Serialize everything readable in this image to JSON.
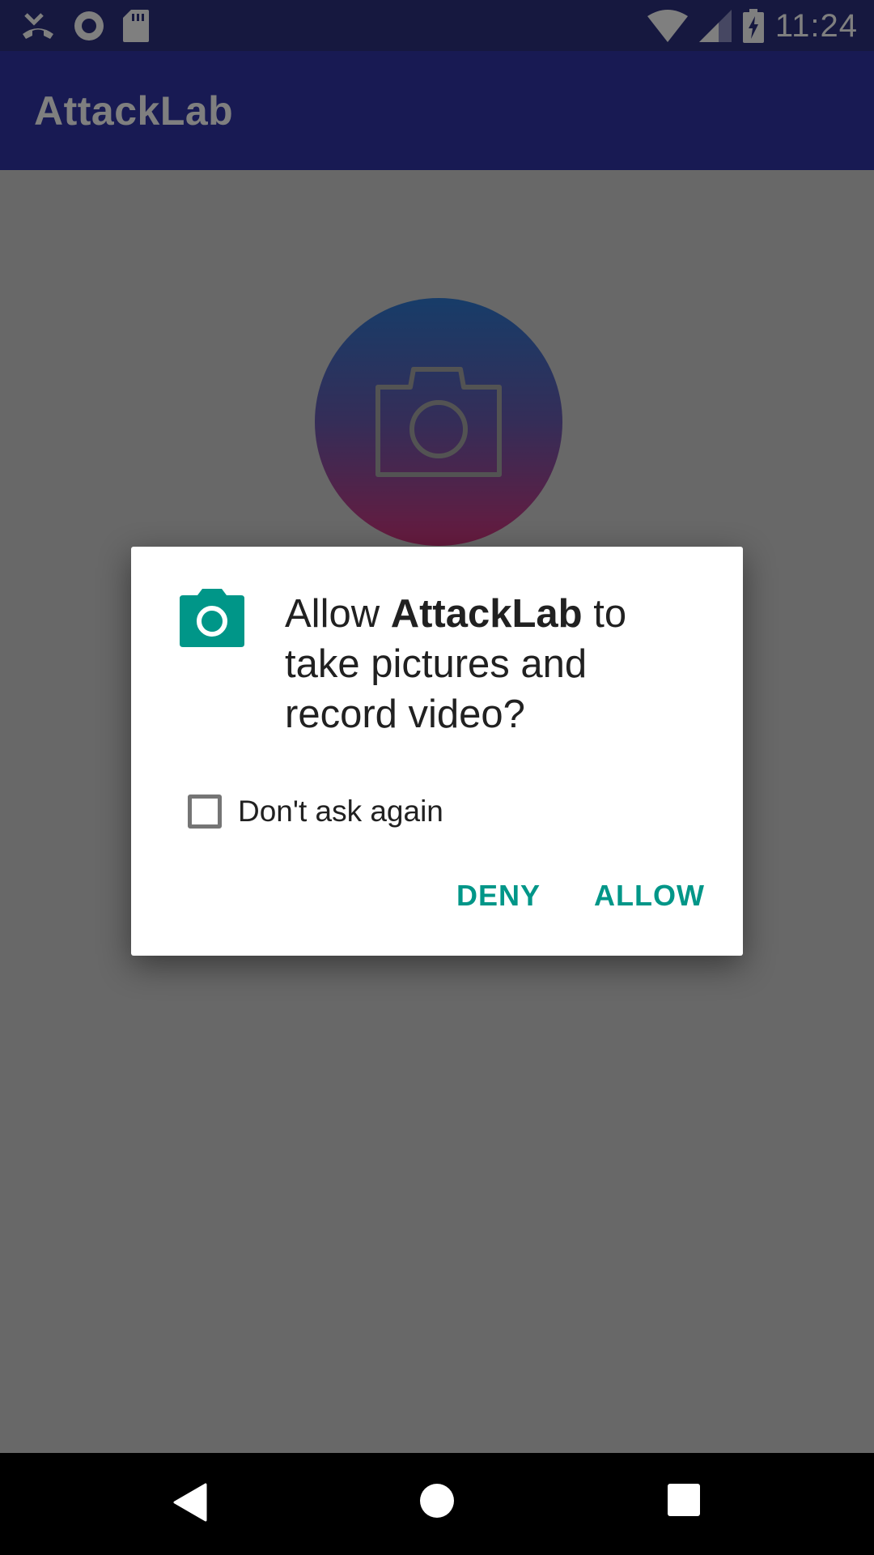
{
  "status_bar": {
    "time": "11:24",
    "left_icons": [
      "missed-call-icon",
      "record-icon",
      "sd-card-icon"
    ],
    "right_icons": [
      "wifi-icon",
      "signal-icon",
      "battery-charging-icon"
    ]
  },
  "app_bar": {
    "title": "AttackLab"
  },
  "content": {
    "icon": "camera-icon"
  },
  "dialog": {
    "icon": "camera-icon",
    "message_prefix": "Allow ",
    "app_name": "AttackLab",
    "message_suffix": " to take pictures and record video?",
    "checkbox_label": "Don't ask again",
    "checkbox_checked": false,
    "deny_label": "DENY",
    "allow_label": "ALLOW",
    "accent_color": "#009688"
  },
  "nav_bar": {
    "buttons": [
      "back-icon",
      "home-icon",
      "recents-icon"
    ]
  }
}
